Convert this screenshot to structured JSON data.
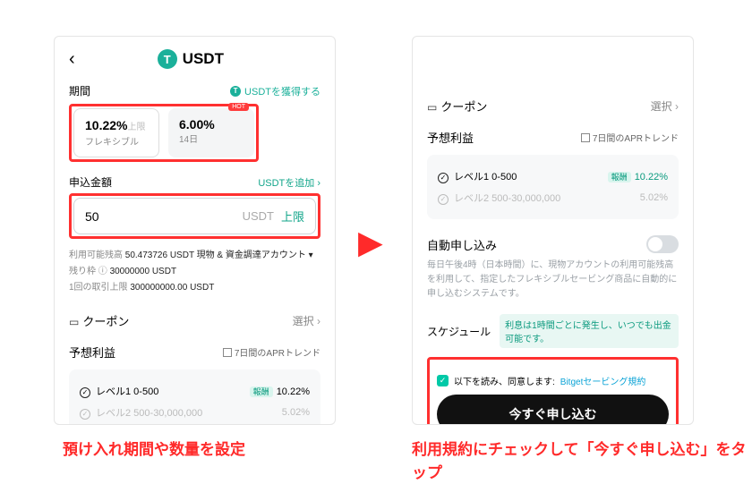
{
  "left": {
    "asset": "USDT",
    "period_label": "期間",
    "earn_text": "USDTを獲得する",
    "flex_rate": "10.22%",
    "flex_rate_suffix": "上限",
    "flex_sub": "フレキシブル",
    "fixed_rate": "6.00%",
    "fixed_sub": "14日",
    "amount_label": "申込金額",
    "add_usdt": "USDTを追加",
    "amount_value": "50",
    "amount_unit": "USDT",
    "amount_btn": "上限",
    "meta": {
      "avail_label": "利用可能残高",
      "avail_value": "50.473726 USDT  現物 & 資金調達アカウント",
      "remain_label": "残り枠",
      "remain_value": "30000000 USDT",
      "per_tx_label": "1回の取引上限",
      "per_tx_value": "300000000.00 USDT"
    },
    "coupon_label": "クーポン",
    "coupon_value": "選択",
    "est_label": "予想利益",
    "apr_trend": "7日間のAPRトレンド",
    "tier1": "レベル1 0-500",
    "tier1_rate": "10.22%",
    "tier1_badge": "報酬",
    "tier2": "レベル2 500-30,000,000",
    "tier2_rate": "5.02%"
  },
  "right": {
    "coupon_label": "クーポン",
    "coupon_value": "選択",
    "est_label": "予想利益",
    "apr_trend": "7日間のAPRトレンド",
    "tier1": "レベル1 0-500",
    "tier1_rate": "10.22%",
    "tier1_badge": "報酬",
    "tier2": "レベル2 500-30,000,000",
    "tier2_rate": "5.02%",
    "auto_label": "自動申し込み",
    "auto_desc": "毎日午後4時（日本時間）に、現物アカウントの利用可能残高を利用して、指定したフレキシブルセービング商品に自動的に申し込むシステムです。",
    "schedule_label": "スケジュール",
    "schedule_note": "利息は1時間ごとに発生し、いつでも出金可能です。",
    "agree_text": "以下を読み、同意します:",
    "agree_link": "Bitgetセービング規約",
    "cta": "今すぐ申し込む"
  },
  "captions": {
    "left": "預け入れ期間や数量を設定",
    "right": "利用規約にチェックして「今すぐ申し込む」をタップ"
  }
}
